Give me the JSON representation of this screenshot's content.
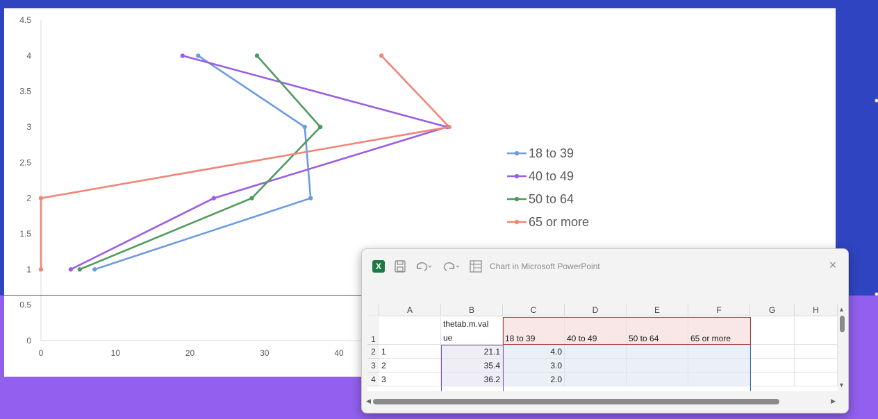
{
  "chart_data": {
    "type": "line",
    "y_ticks": [
      "0",
      "0.5",
      "1",
      "1.5",
      "2",
      "2.5",
      "3",
      "3.5",
      "4",
      "4.5"
    ],
    "x_ticks": [
      "0",
      "10",
      "20",
      "30",
      "40"
    ],
    "xlim": [
      0,
      40
    ],
    "ylim": [
      0,
      4.5
    ],
    "grid": false,
    "legend_position": "right",
    "series": [
      {
        "name": "18 to 39",
        "color": "#6b9be0",
        "x": [
          7.2,
          36.2,
          35.4,
          21.1
        ],
        "y": [
          1,
          2,
          3,
          4
        ]
      },
      {
        "name": "40 to 49",
        "color": "#9a5fe2",
        "x": [
          4.0,
          23.2,
          54.5,
          19.0
        ],
        "y": [
          1,
          2,
          3,
          4
        ]
      },
      {
        "name": "50 to 64",
        "color": "#4e9a5c",
        "x": [
          5.2,
          28.3,
          37.5,
          29.0
        ],
        "y": [
          1,
          2,
          3,
          4
        ]
      },
      {
        "name": "65 or more",
        "color": "#ef8677",
        "x": [
          0.0,
          0.0,
          54.8,
          45.7
        ],
        "y": [
          1,
          2,
          3,
          4
        ]
      }
    ]
  },
  "excel": {
    "title": "Chart in Microsoft PowerPoint",
    "logo_letter": "X",
    "close_glyph": "×",
    "columns": [
      "A",
      "B",
      "C",
      "D",
      "E",
      "F",
      "G",
      "H"
    ],
    "rows": [
      "1",
      "2",
      "3",
      "4"
    ],
    "header_row": {
      "b_line1": "thetab.m.val",
      "b_line2": "ue",
      "c": "18 to 39",
      "d": "40 to 49",
      "e": "50 to 64",
      "f": "65 or more"
    },
    "data_rows": [
      {
        "a": "1",
        "b": "21.1",
        "c": "4.0"
      },
      {
        "a": "2",
        "b": "35.4",
        "c": "3.0"
      },
      {
        "a": "3",
        "b": "36.2",
        "c": "2.0"
      }
    ],
    "scroll_up": "▲",
    "scroll_down": "▼",
    "scroll_left": "◀",
    "scroll_right": "▶"
  },
  "icons": [
    "excel-logo-icon",
    "save-icon",
    "undo-icon",
    "redo-icon",
    "table-icon",
    "close-icon"
  ]
}
